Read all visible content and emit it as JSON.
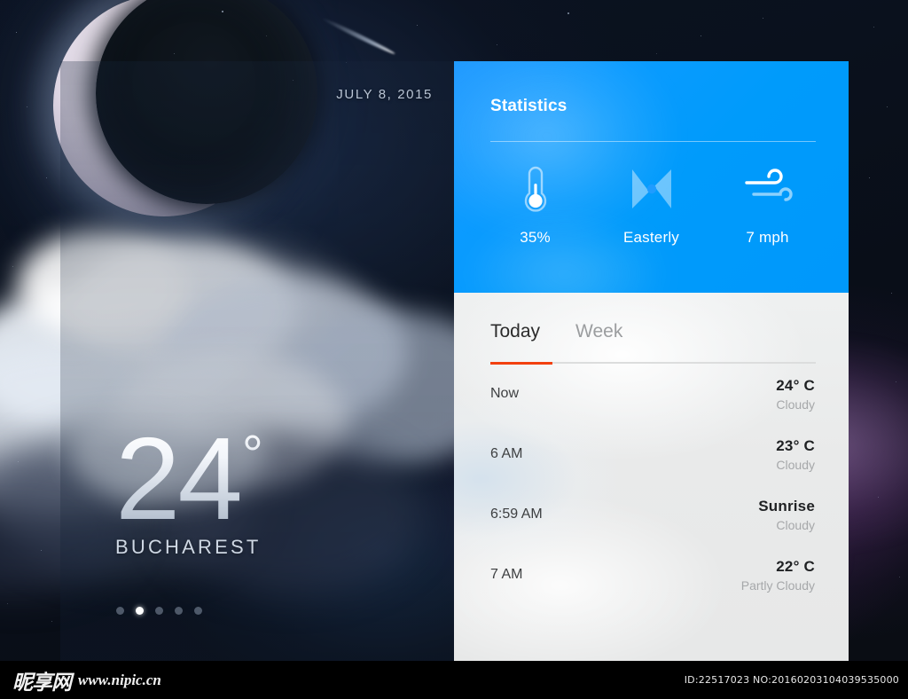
{
  "hero": {
    "date": "JULY 8, 2015",
    "temperature": "24",
    "degree_symbol": "°",
    "city": "BUCHAREST",
    "pager": {
      "count": 5,
      "active_index": 1
    }
  },
  "statistics": {
    "title": "Statistics",
    "accent_color": "#0099fb",
    "items": [
      {
        "icon": "thermometer-icon",
        "value": "35%"
      },
      {
        "icon": "compass-icon",
        "value": "Easterly"
      },
      {
        "icon": "wind-icon",
        "value": "7 mph"
      }
    ]
  },
  "forecast": {
    "tabs": [
      {
        "label": "Today",
        "active": true
      },
      {
        "label": "Week",
        "active": false
      }
    ],
    "underline_color": "#f2400f",
    "rows": [
      {
        "time": "Now",
        "temp": "24° C",
        "condition": "Cloudy"
      },
      {
        "time": "6 AM",
        "temp": "23° C",
        "condition": "Cloudy"
      },
      {
        "time": "6:59 AM",
        "temp": "Sunrise",
        "condition": "Cloudy"
      },
      {
        "time": "7 AM",
        "temp": "22° C",
        "condition": "Partly Cloudy"
      }
    ]
  },
  "watermark": {
    "logo": "昵享网",
    "url": "www.nipic.cn",
    "id": "ID:22517023 NO:20160203104039535000"
  }
}
